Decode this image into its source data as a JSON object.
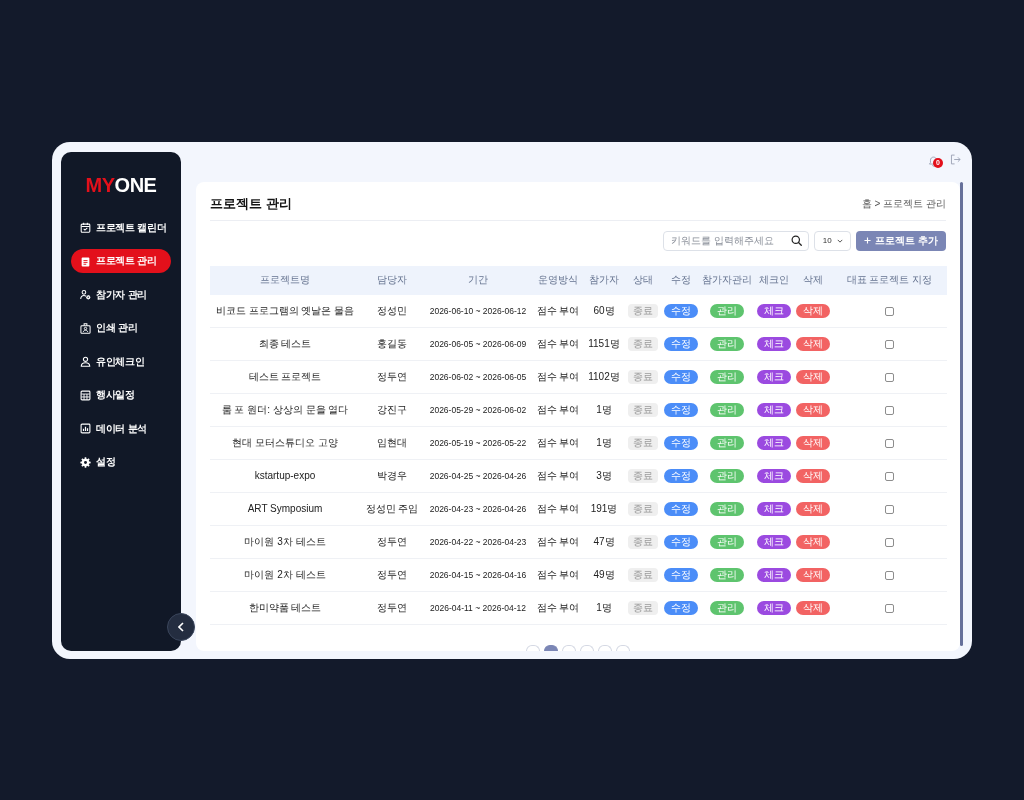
{
  "logo": {
    "accent_text": "MY",
    "text": "ONE"
  },
  "sidebar": {
    "items": [
      {
        "label": "프로젝트 캘린더",
        "selected": false
      },
      {
        "label": "프로젝트 관리",
        "selected": true
      },
      {
        "label": "참가자 관리",
        "selected": false
      },
      {
        "label": "인쇄 관리",
        "selected": false
      },
      {
        "label": "유인체크인",
        "selected": false
      },
      {
        "label": "행사일정",
        "selected": false
      },
      {
        "label": "데이터 분석",
        "selected": false
      },
      {
        "label": "설정",
        "selected": false
      }
    ]
  },
  "topbar": {
    "notification_count": "0"
  },
  "page": {
    "title": "프로젝트 관리",
    "breadcrumb": "홈 > 프로젝트 관리"
  },
  "toolbar": {
    "search": {
      "placeholder": "키워드를 입력해주세요"
    },
    "page_size": "10",
    "add_button": "프로젝트 추가"
  },
  "table": {
    "columns": [
      "프로젝트명",
      "담당자",
      "기간",
      "운영방식",
      "참가자",
      "상태",
      "수정",
      "참가자관리",
      "체크인",
      "삭제",
      "대표 프로젝트 지정"
    ],
    "rows": [
      {
        "project": "비코드 프로그램의 옛날은 물음",
        "manager": "정성민",
        "period": "2026-06-10 ~ 2026-06-12",
        "mode": "점수 부여",
        "participants": "60명",
        "status": "종료",
        "edit": "수정",
        "manage": "관리",
        "checkin": "체크",
        "delete": "삭제",
        "featured": false
      },
      {
        "project": "최종 테스트",
        "manager": "홍길동",
        "period": "2026-06-05 ~ 2026-06-09",
        "mode": "점수 부여",
        "participants": "1151명",
        "status": "종료",
        "edit": "수정",
        "manage": "관리",
        "checkin": "체크",
        "delete": "삭제",
        "featured": false
      },
      {
        "project": "테스트 프로젝트",
        "manager": "정두연",
        "period": "2026-06-02 ~ 2026-06-05",
        "mode": "점수 부여",
        "participants": "1102명",
        "status": "종료",
        "edit": "수정",
        "manage": "관리",
        "checkin": "체크",
        "delete": "삭제",
        "featured": false
      },
      {
        "project": "룸 포 원더: 상상의 문을 열다",
        "manager": "강진구",
        "period": "2026-05-29 ~ 2026-06-02",
        "mode": "점수 부여",
        "participants": "1명",
        "status": "종료",
        "edit": "수정",
        "manage": "관리",
        "checkin": "체크",
        "delete": "삭제",
        "featured": false
      },
      {
        "project": "현대 모터스튜디오 고양",
        "manager": "임현대",
        "period": "2026-05-19 ~ 2026-05-22",
        "mode": "점수 부여",
        "participants": "1명",
        "status": "종료",
        "edit": "수정",
        "manage": "관리",
        "checkin": "체크",
        "delete": "삭제",
        "featured": false
      },
      {
        "project": "kstartup-expo",
        "manager": "박경우",
        "period": "2026-04-25 ~ 2026-04-26",
        "mode": "점수 부여",
        "participants": "3명",
        "status": "종료",
        "edit": "수정",
        "manage": "관리",
        "checkin": "체크",
        "delete": "삭제",
        "featured": false
      },
      {
        "project": "ART Symposium",
        "manager": "정성민 주임",
        "period": "2026-04-23 ~ 2026-04-26",
        "mode": "점수 부여",
        "participants": "191명",
        "status": "종료",
        "edit": "수정",
        "manage": "관리",
        "checkin": "체크",
        "delete": "삭제",
        "featured": false
      },
      {
        "project": "마이원 3차 테스트",
        "manager": "정두연",
        "period": "2026-04-22 ~ 2026-04-23",
        "mode": "점수 부여",
        "participants": "47명",
        "status": "종료",
        "edit": "수정",
        "manage": "관리",
        "checkin": "체크",
        "delete": "삭제",
        "featured": false
      },
      {
        "project": "마이원 2차 테스트",
        "manager": "정두연",
        "period": "2026-04-15 ~ 2026-04-16",
        "mode": "점수 부여",
        "participants": "49명",
        "status": "종료",
        "edit": "수정",
        "manage": "관리",
        "checkin": "체크",
        "delete": "삭제",
        "featured": false
      },
      {
        "project": "한미약품 테스트",
        "manager": "정두연",
        "period": "2026-04-11 ~ 2026-04-12",
        "mode": "점수 부여",
        "participants": "1명",
        "status": "종료",
        "edit": "수정",
        "manage": "관리",
        "checkin": "체크",
        "delete": "삭제",
        "featured": false
      }
    ]
  },
  "pagination": [
    {
      "selected": false
    },
    {
      "selected": true
    },
    {
      "selected": false
    },
    {
      "selected": false
    },
    {
      "selected": false
    },
    {
      "selected": false
    }
  ]
}
